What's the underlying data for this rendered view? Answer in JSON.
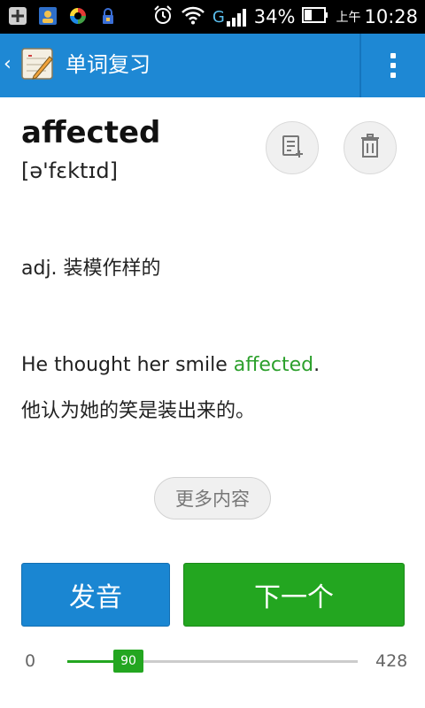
{
  "status_bar": {
    "battery": "34%",
    "ampm": "上午",
    "time": "10:28",
    "network": "G"
  },
  "action_bar": {
    "title": "单词复习"
  },
  "word": {
    "headword": "affected",
    "phonetic": "[ə'fɛktɪd]",
    "definition": "adj. 装模作样的",
    "example_before": "He thought her smile ",
    "example_highlight": "affected",
    "example_after": ".",
    "example_translation": "他认为她的笑是装出来的。"
  },
  "buttons": {
    "more": "更多内容",
    "pronounce": "发音",
    "next": "下一个"
  },
  "progress": {
    "min": "0",
    "max": "428",
    "value": "90",
    "value_number": 90,
    "max_number": 428
  },
  "colors": {
    "action_bar": "#1e88d4",
    "accent_green": "#23a620",
    "pronounce_blue": "#1a86d2"
  }
}
